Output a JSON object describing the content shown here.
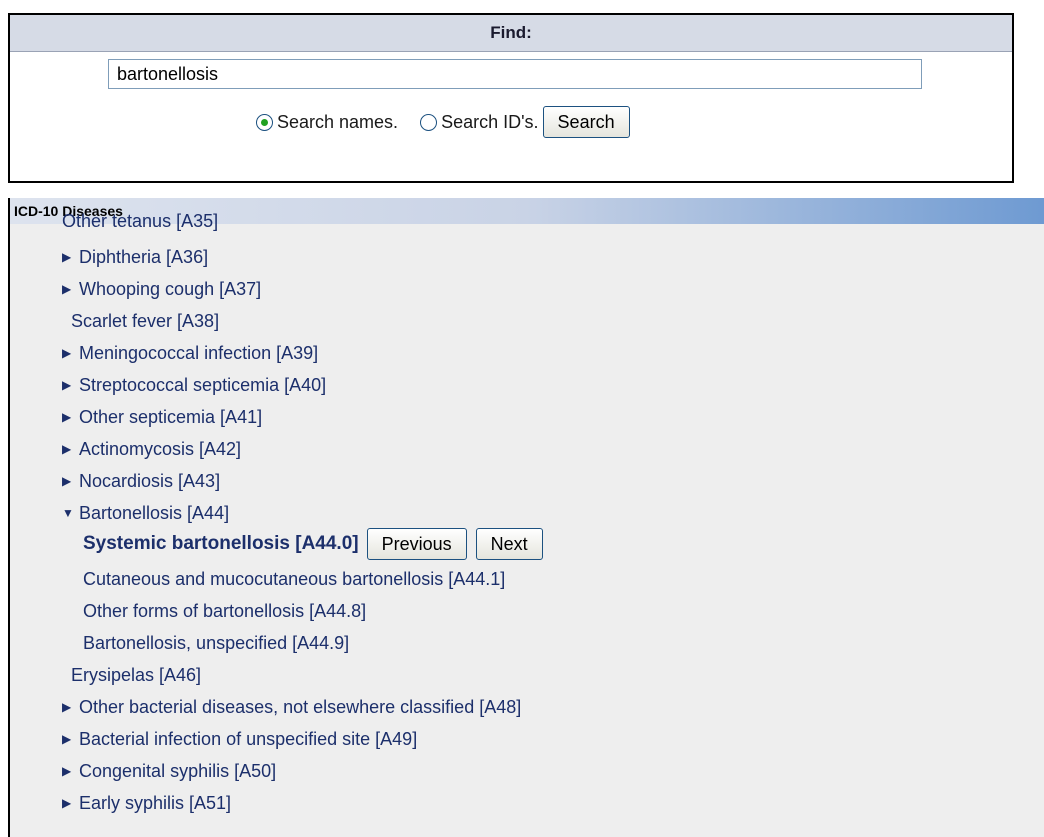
{
  "find": {
    "header": "Find:",
    "query": "bartonellosis",
    "radio_names_label": "Search names.",
    "radio_ids_label": "Search ID's.",
    "search_button": "Search"
  },
  "tree": {
    "title": "ICD-10 Diseases",
    "clipped_item": "Other tetanus [A35]",
    "items": [
      {
        "label": "Diphtheria [A36]"
      },
      {
        "label": "Whooping cough [A37]"
      },
      {
        "label": "Scarlet fever [A38]"
      },
      {
        "label": "Meningococcal infection [A39]"
      },
      {
        "label": "Streptococcal septicemia [A40]"
      },
      {
        "label": "Other septicemia [A41]"
      },
      {
        "label": "Actinomycosis [A42]"
      },
      {
        "label": "Nocardiosis [A43]"
      },
      {
        "label": "Bartonellosis [A44]"
      },
      {
        "label": "Systemic bartonellosis [A44.0]"
      },
      {
        "label": "Cutaneous and mucocutaneous bartonellosis [A44.1]"
      },
      {
        "label": "Other forms of bartonellosis [A44.8]"
      },
      {
        "label": "Bartonellosis, unspecified [A44.9]"
      },
      {
        "label": "Erysipelas [A46]"
      },
      {
        "label": "Other bacterial diseases, not elsewhere classified [A48]"
      },
      {
        "label": "Bacterial infection of unspecified site [A49]"
      },
      {
        "label": "Congenital syphilis [A50]"
      },
      {
        "label": "Early syphilis [A51]"
      }
    ],
    "previous_button": "Previous",
    "next_button": "Next"
  }
}
